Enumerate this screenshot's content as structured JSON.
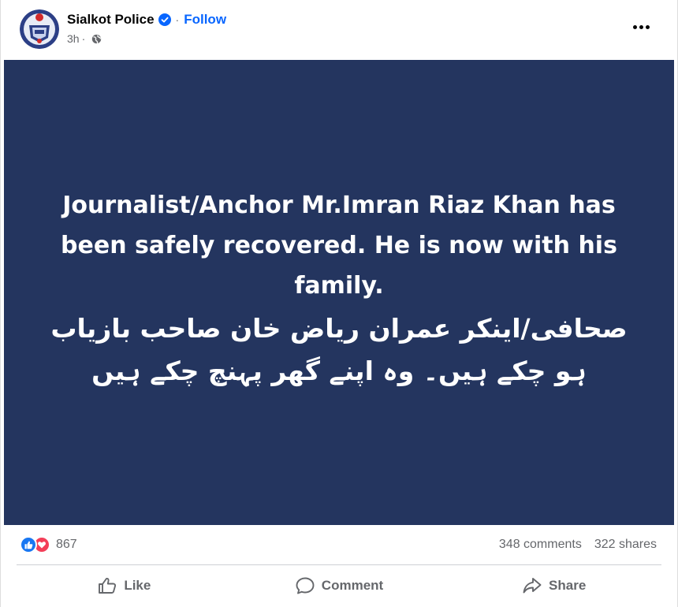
{
  "post": {
    "page_name": "Sialkot Police",
    "follow_label": "Follow",
    "separator": "·",
    "time": "3h",
    "more_icon": "ellipsis-icon",
    "image": {
      "background": "#24355f",
      "english_text": "Journalist/Anchor Mr.Imran Riaz Khan has been safely recovered. He is now with his family.",
      "urdu_text": "صحافی/اینکر عمران ریاض خان صاحب بازیاب ہو چکے ہیں۔ وہ اپنے گھر پہنچ چکے ہیں"
    }
  },
  "stats": {
    "reaction_count": "867",
    "comments": "348 comments",
    "shares": "322 shares"
  },
  "actions": {
    "like": "Like",
    "comment": "Comment",
    "share": "Share"
  },
  "colors": {
    "accent": "#0866ff",
    "like_reaction": "#1877f2",
    "love_reaction": "#f33e58",
    "secondary_text": "#65676b"
  }
}
